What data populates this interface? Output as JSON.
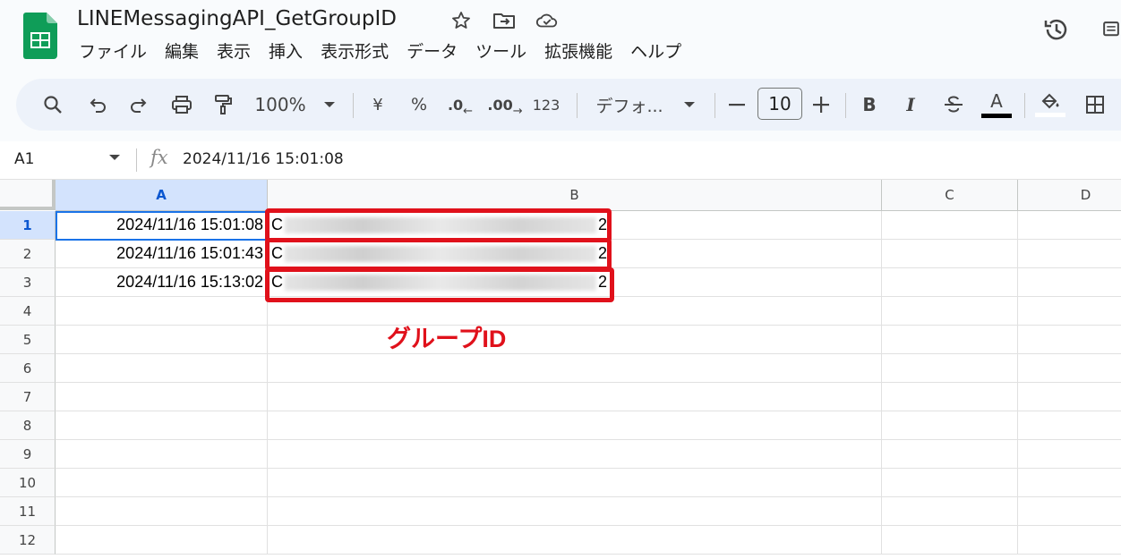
{
  "app": {
    "title": "LINEMessagingAPI_GetGroupID",
    "brand_color": "#0f9d58"
  },
  "menubar": [
    "ファイル",
    "編集",
    "表示",
    "挿入",
    "表示形式",
    "データ",
    "ツール",
    "拡張機能",
    "ヘルプ"
  ],
  "toolbar": {
    "zoom": "100%",
    "currency": "¥",
    "percent": "%",
    "decrease_decimal": ".0",
    "increase_decimal": ".00",
    "number_format": "123",
    "font": "デフォ...",
    "font_size": "10",
    "bold": "B",
    "italic": "I",
    "text_color_letter": "A"
  },
  "formula_bar": {
    "cell_ref": "A1",
    "fx": "fx",
    "value": "2024/11/16 15:01:08"
  },
  "sheet": {
    "columns": [
      "A",
      "B",
      "C",
      "D"
    ],
    "rows": [
      "1",
      "2",
      "3",
      "4",
      "5",
      "6",
      "7",
      "8",
      "9",
      "10",
      "11",
      "12"
    ],
    "data": [
      {
        "a": "2024/11/16 15:01:08",
        "b_start": "C",
        "b_end": "2"
      },
      {
        "a": "2024/11/16 15:01:43",
        "b_start": "C",
        "b_end": "2"
      },
      {
        "a": "2024/11/16 15:13:02",
        "b_start": "C",
        "b_end": "2"
      }
    ]
  },
  "annotation": {
    "label": "グループID",
    "color": "#e0111b"
  }
}
